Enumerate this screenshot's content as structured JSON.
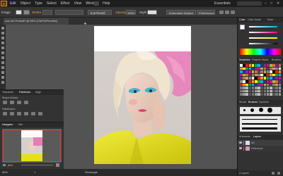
{
  "menubar": {
    "logo": "Ai",
    "menus": [
      "Edit",
      "Object",
      "Type",
      "Select",
      "Effect",
      "View",
      "Window",
      "Help"
    ],
    "workspace": "Essentials"
  },
  "control_bar": {
    "no_selection": "Image",
    "stroke_label": "Stroke",
    "brush": "5 pt Round",
    "opacity_label": "Opacity",
    "opacity_value": "100%",
    "style_label": "Style",
    "embed_button": "Embedded Subject",
    "preferences_button": "Preferences"
  },
  "document_tab": {
    "title": "Lion Art Portrait* @ 66% (CMYK/Preview)"
  },
  "status_bar": {
    "zoom": "66%",
    "page": "1",
    "tool": "Rectangle"
  },
  "right_panel": {
    "color_tabs": [
      "Color",
      "Color Guide",
      "Kuler"
    ],
    "swatch_tabs": [
      "Swatches",
      "Graphic Styles",
      "Brushes"
    ],
    "brush_tabs": [
      "Stroke",
      "Brushes",
      "Symbols"
    ],
    "layers_tabs": [
      "Artboards",
      "Layers"
    ],
    "layers": [
      {
        "name": "Art"
      },
      {
        "name": "Reference"
      }
    ],
    "layers_count": "2 Layers"
  },
  "left_panel": {
    "tabs": [
      "Transform",
      "Pathfinder",
      "Align"
    ],
    "shape_modes_label": "Shape Modes:",
    "pathfinders_label": "Pathfinders:"
  },
  "navigator": {
    "tabs": [
      "Navigator",
      "Info"
    ],
    "zoom": "66%"
  },
  "colors": {
    "accent": "#ff9a00",
    "hair_pink": "#e86ab0",
    "shirt_yellow": "#e6e01a"
  }
}
